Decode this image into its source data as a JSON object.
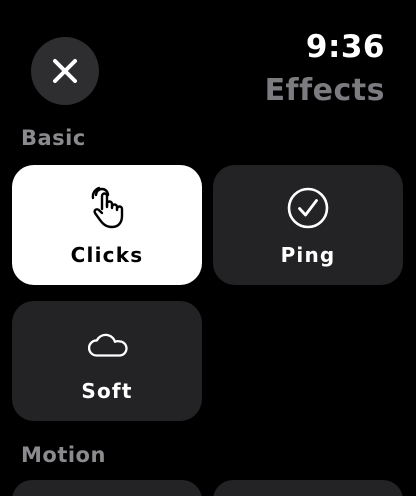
{
  "header": {
    "time": "9:36",
    "title": "Effects",
    "close_icon": "close-icon"
  },
  "sections": {
    "basic": {
      "label": "Basic",
      "items": [
        {
          "label": "Clicks",
          "icon": "hand-tap-icon",
          "selected": true
        },
        {
          "label": "Ping",
          "icon": "checkmark-circle-icon",
          "selected": false
        },
        {
          "label": "Soft",
          "icon": "cloud-icon",
          "selected": false
        }
      ]
    },
    "motion": {
      "label": "Motion"
    }
  },
  "colors": {
    "background": "#000000",
    "tile": "#232325",
    "tile_selected": "#ffffff",
    "title_gray": "#7c7c80",
    "section_gray": "#8b8b8f"
  }
}
